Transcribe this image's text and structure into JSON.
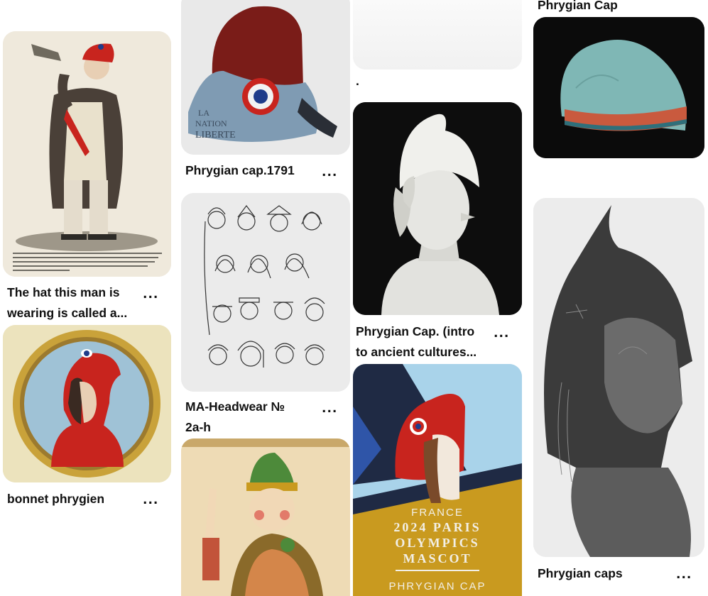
{
  "pins": [
    {
      "title": "The hat this man is",
      "title2": "wearing is called a...",
      "more": "..."
    },
    {
      "title": "bonnet phrygien",
      "more": "..."
    },
    {
      "title": "Phrygian cap.1791",
      "more": "..."
    },
    {
      "title": "MA-Headwear №",
      "title2": "2a-h",
      "more": "..."
    },
    {
      "title": "."
    },
    {
      "title": "Phrygian Cap. (intro",
      "title2": "to ancient cultures...",
      "more": "..."
    },
    {
      "title": "Phrygian Cap"
    },
    {
      "title": "Phrygian caps",
      "more": "..."
    }
  ],
  "images": {
    "cap1791_text1": "LA",
    "cap1791_text2": "NATION",
    "cap1791_text3": "LIBERTE",
    "olympics_line1": "FRANCE",
    "olympics_line2": "2024 PARIS",
    "olympics_line3": "OLYMPICS",
    "olympics_line4": "MASCOT",
    "olympics_line5": "PHRYGIAN CAP"
  },
  "colors": {
    "phrygian_red": "#c8241e",
    "olympics_gold": "#c99a1f",
    "olympics_navy": "#1f2a44",
    "olympics_sky": "#a9d3ea"
  }
}
